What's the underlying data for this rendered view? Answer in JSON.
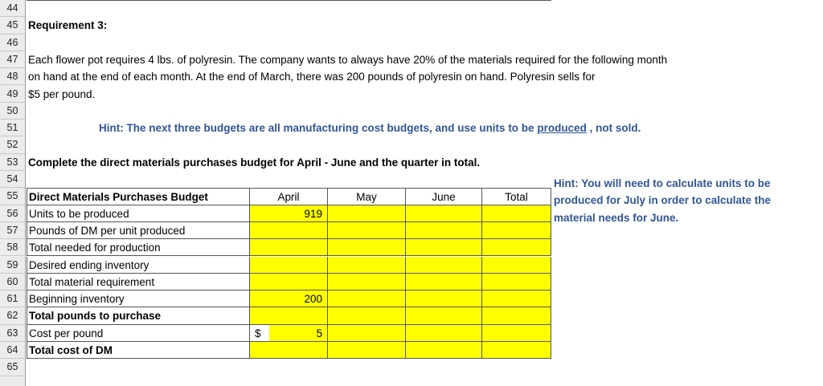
{
  "rows": [
    "44",
    "45",
    "46",
    "47",
    "48",
    "49",
    "50",
    "51",
    "52",
    "53",
    "54",
    "55",
    "56",
    "57",
    "58",
    "59",
    "60",
    "61",
    "62",
    "63",
    "64",
    "65"
  ],
  "requirement_title": "Requirement 3:",
  "paragraph": [
    "Each flower  pot requires 4 lbs. of polyresin.  The company wants to always have 20% of the materials required for the following month",
    "on hand at the end of each month.   At the end of March, there was  200 pounds of polyresin on hand.  Polyresin sells for",
    "$5 per pound."
  ],
  "hint_main": {
    "prefix": "Hint:  The next three budgets are all manufacturing cost budgets, and use units to be ",
    "underlined": "produced",
    "suffix": " , not sold."
  },
  "instruction": "Complete the direct materials purchases budget for April - June and the quarter in total.",
  "hint_side": "Hint:  You will need to calculate units to be produced for July in order to calculate the material needs for June.",
  "budget": {
    "title": "Direct Materials Purchases Budget",
    "columns": [
      "April",
      "May",
      "June",
      "Total"
    ],
    "lines": [
      {
        "label": "Units to be produced",
        "bold": false,
        "april": "919"
      },
      {
        "label": "Pounds of DM per unit produced",
        "bold": false,
        "april": ""
      },
      {
        "label": "Total needed for production",
        "bold": false,
        "april": ""
      },
      {
        "label": "Desired ending inventory",
        "bold": false,
        "april": ""
      },
      {
        "label": "Total material requirement",
        "bold": false,
        "april": ""
      },
      {
        "label": "Beginning inventory",
        "bold": false,
        "april": "200"
      },
      {
        "label": "Total pounds to purchase",
        "bold": true,
        "april": ""
      },
      {
        "label": "Cost per pound",
        "bold": false,
        "april": "5",
        "currency": "$"
      },
      {
        "label": "Total cost of DM",
        "bold": true,
        "april": ""
      }
    ]
  },
  "colors": {
    "highlight": "#ffff00",
    "hint_text": "#2f5597"
  }
}
